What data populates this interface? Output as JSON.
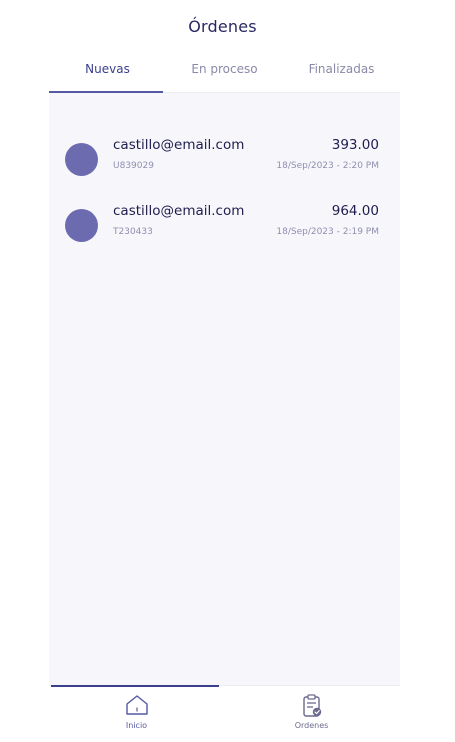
{
  "header": {
    "title": "Órdenes"
  },
  "tabs": [
    {
      "label": "Nuevas",
      "active": true
    },
    {
      "label": "En proceso",
      "active": false
    },
    {
      "label": "Finalizadas",
      "active": false
    }
  ],
  "orders": [
    {
      "email": "castillo@email.com",
      "code": "U839029",
      "amount": "393.00",
      "date": "18/Sep/2023 - 2:20 PM"
    },
    {
      "email": "castillo@email.com",
      "code": "T230433",
      "amount": "964.00",
      "date": "18/Sep/2023 - 2:19 PM"
    }
  ],
  "bottom_nav": [
    {
      "label": "Inicio",
      "icon": "home-icon",
      "active": true
    },
    {
      "label": "Ordenes",
      "icon": "clipboard-check-icon",
      "active": false
    }
  ],
  "colors": {
    "accent": "#3b3f8c",
    "avatar": "#6c6bb0",
    "background": "#f7f7fb"
  }
}
